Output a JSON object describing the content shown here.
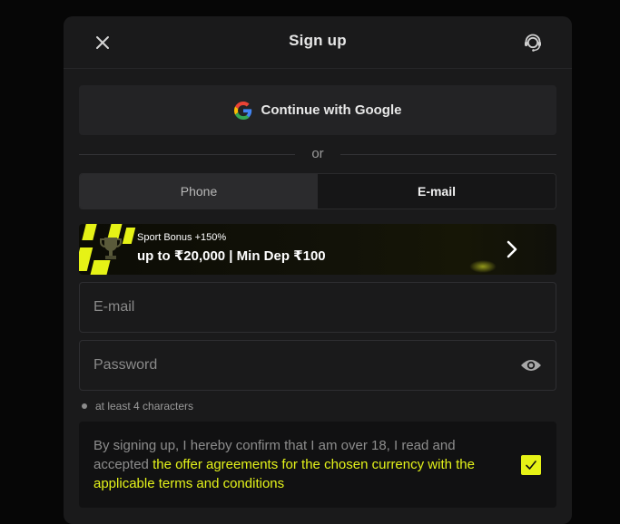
{
  "header": {
    "title": "Sign up",
    "close_icon": "close-icon",
    "support_icon": "headset-support-icon"
  },
  "google": {
    "label": "Continue with Google",
    "icon": "google-logo-icon"
  },
  "divider": {
    "text": "or"
  },
  "tabs": [
    {
      "label": "Phone",
      "active": false
    },
    {
      "label": "E-mail",
      "active": true
    }
  ],
  "bonus": {
    "small_text": "Sport Bonus +150%",
    "big_text": "up to ₹20,000 | Min Dep ₹100",
    "arrow_icon": "chevron-right-icon",
    "accent": "#e6f216"
  },
  "form": {
    "email_placeholder": "E-mail",
    "email_value": "",
    "password_placeholder": "Password",
    "password_value": "",
    "eye_icon": "eye-icon",
    "password_hint": "at least 4 characters"
  },
  "agreement": {
    "text": "By signing up, I hereby confirm that I am over 18, I read and accepted",
    "link_text": "the offer agreements for the chosen currency with the applicable terms and conditions",
    "checked": true,
    "check_icon": "checkmark-icon"
  },
  "colors": {
    "background": "#060606",
    "modal": "#1a1a1b",
    "accent": "#e4f31a"
  }
}
